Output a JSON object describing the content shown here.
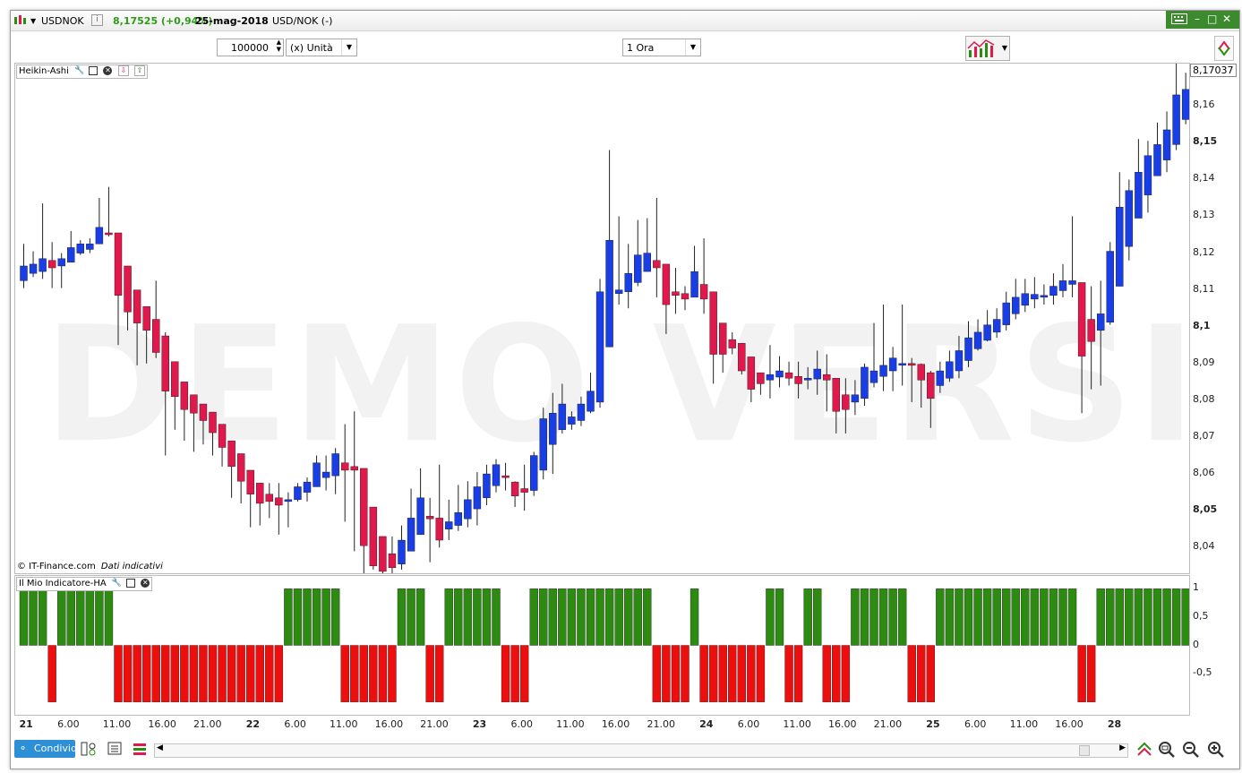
{
  "title_bar": {
    "symbol": "USDNOK",
    "price_change": "8,17525 (+0,94%)",
    "date": "25-mag-2018",
    "pair": "USD/NOK (-)"
  },
  "toolbar": {
    "quantity": "100000",
    "unit": "(x) Unità",
    "timeframe": "1 Ora"
  },
  "price_pane": {
    "label": "Heikin-Ashi",
    "current_price_tag": "8,17037",
    "copyright": "© IT-Finance.com",
    "disclaimer": "Dati indicativi",
    "watermark": "DEMO VERSION",
    "y_ticks": [
      "8,16",
      "8,15",
      "8,14",
      "8,13",
      "8,12",
      "8,11",
      "8,1",
      "8,09",
      "8,08",
      "8,07",
      "8,06",
      "8,05",
      "8,04"
    ]
  },
  "indicator_pane": {
    "label": "Il Mio Indicatore-HA",
    "y_ticks": [
      "1",
      "0,5",
      "0",
      "-0,5"
    ]
  },
  "x_axis": {
    "ticks": [
      "21",
      "6.00",
      "11.00",
      "16.00",
      "21.00",
      "22",
      "6.00",
      "11.00",
      "16.00",
      "21.00",
      "23",
      "6.00",
      "11.00",
      "16.00",
      "21.00",
      "24",
      "6.00",
      "11.00",
      "16.00",
      "21.00",
      "25",
      "6.00",
      "11.00",
      "16.00",
      "28"
    ],
    "day_ticks": [
      "21",
      "22",
      "23",
      "24",
      "25",
      "28"
    ]
  },
  "bottom_bar": {
    "share_label": "Condividi"
  },
  "colors": {
    "bull": "#1a3ee6",
    "bear": "#e0184c",
    "ind_pos": "#2e8b12",
    "ind_neg": "#ee0e0e",
    "accent": "#3d8a2e"
  },
  "chart_data": {
    "type": "candlestick",
    "ylim": [
      8.033,
      8.1715
    ],
    "candles": [
      {
        "o": 8.1125,
        "c": 8.1165,
        "h": 8.1225,
        "l": 8.1105,
        "dir": "up"
      },
      {
        "o": 8.1145,
        "c": 8.117,
        "h": 8.1205,
        "l": 8.1135,
        "dir": "up"
      },
      {
        "o": 8.115,
        "c": 8.1185,
        "h": 8.1335,
        "l": 8.113,
        "dir": "up"
      },
      {
        "o": 8.118,
        "c": 8.116,
        "h": 8.123,
        "l": 8.1105,
        "dir": "down"
      },
      {
        "o": 8.1165,
        "c": 8.1185,
        "h": 8.12,
        "l": 8.1105,
        "dir": "up"
      },
      {
        "o": 8.1175,
        "c": 8.1215,
        "h": 8.126,
        "l": 8.1175,
        "dir": "up"
      },
      {
        "o": 8.12,
        "c": 8.1225,
        "h": 8.1235,
        "l": 8.1195,
        "dir": "up"
      },
      {
        "o": 8.121,
        "c": 8.1225,
        "h": 8.124,
        "l": 8.12,
        "dir": "up"
      },
      {
        "o": 8.1225,
        "c": 8.127,
        "h": 8.135,
        "l": 8.1225,
        "dir": "up"
      },
      {
        "o": 8.1255,
        "c": 8.125,
        "h": 8.138,
        "l": 8.1245,
        "dir": "down"
      },
      {
        "o": 8.1255,
        "c": 8.1085,
        "h": 8.1255,
        "l": 8.095,
        "dir": "down"
      },
      {
        "o": 8.1165,
        "c": 8.104,
        "h": 8.1165,
        "l": 8.099,
        "dir": "down"
      },
      {
        "o": 8.11,
        "c": 8.101,
        "h": 8.11,
        "l": 8.0895,
        "dir": "down"
      },
      {
        "o": 8.1055,
        "c": 8.099,
        "h": 8.1055,
        "l": 8.09,
        "dir": "down"
      },
      {
        "o": 8.102,
        "c": 8.093,
        "h": 8.1125,
        "l": 8.0915,
        "dir": "down"
      },
      {
        "o": 8.0975,
        "c": 8.0825,
        "h": 8.0985,
        "l": 8.065,
        "dir": "down"
      },
      {
        "o": 8.0905,
        "c": 8.081,
        "h": 8.0905,
        "l": 8.072,
        "dir": "down"
      },
      {
        "o": 8.085,
        "c": 8.0775,
        "h": 8.085,
        "l": 8.069,
        "dir": "down"
      },
      {
        "o": 8.0815,
        "c": 8.0765,
        "h": 8.0815,
        "l": 8.066,
        "dir": "down"
      },
      {
        "o": 8.079,
        "c": 8.0745,
        "h": 8.079,
        "l": 8.068,
        "dir": "down"
      },
      {
        "o": 8.0768,
        "c": 8.0712,
        "h": 8.0768,
        "l": 8.065,
        "dir": "down"
      },
      {
        "o": 8.0735,
        "c": 8.0672,
        "h": 8.0735,
        "l": 8.062,
        "dir": "down"
      },
      {
        "o": 8.069,
        "c": 8.062,
        "h": 8.069,
        "l": 8.0535,
        "dir": "down"
      },
      {
        "o": 8.0655,
        "c": 8.058,
        "h": 8.0655,
        "l": 8.052,
        "dir": "down"
      },
      {
        "o": 8.061,
        "c": 8.0545,
        "h": 8.061,
        "l": 8.0455,
        "dir": "down"
      },
      {
        "o": 8.0575,
        "c": 8.052,
        "h": 8.0575,
        "l": 8.046,
        "dir": "down"
      },
      {
        "o": 8.0545,
        "c": 8.0525,
        "h": 8.0575,
        "l": 8.048,
        "dir": "down"
      },
      {
        "o": 8.0535,
        "c": 8.0515,
        "h": 8.0575,
        "l": 8.0435,
        "dir": "down"
      },
      {
        "o": 8.0525,
        "c": 8.053,
        "h": 8.055,
        "l": 8.0455,
        "dir": "up"
      },
      {
        "o": 8.053,
        "c": 8.0565,
        "h": 8.0575,
        "l": 8.0525,
        "dir": "up"
      },
      {
        "o": 8.055,
        "c": 8.0578,
        "h": 8.059,
        "l": 8.0525,
        "dir": "up"
      },
      {
        "o": 8.0565,
        "c": 8.063,
        "h": 8.065,
        "l": 8.0565,
        "dir": "up"
      },
      {
        "o": 8.059,
        "c": 8.0605,
        "h": 8.065,
        "l": 8.0555,
        "dir": "up"
      },
      {
        "o": 8.0595,
        "c": 8.0655,
        "h": 8.067,
        "l": 8.0545,
        "dir": "up"
      },
      {
        "o": 8.063,
        "c": 8.061,
        "h": 8.0735,
        "l": 8.047,
        "dir": "down"
      },
      {
        "o": 8.062,
        "c": 8.061,
        "h": 8.077,
        "l": 8.039,
        "dir": "down"
      },
      {
        "o": 8.0615,
        "c": 8.0405,
        "h": 8.0615,
        "l": 8.033,
        "dir": "down"
      },
      {
        "o": 8.051,
        "c": 8.035,
        "h": 8.051,
        "l": 8.034,
        "dir": "down"
      },
      {
        "o": 8.043,
        "c": 8.0335,
        "h": 8.043,
        "l": 8.031,
        "dir": "down"
      },
      {
        "o": 8.0383,
        "c": 8.0345,
        "h": 8.043,
        "l": 8.032,
        "dir": "down"
      },
      {
        "o": 8.0355,
        "c": 8.042,
        "h": 8.046,
        "l": 8.034,
        "dir": "up"
      },
      {
        "o": 8.039,
        "c": 8.048,
        "h": 8.056,
        "l": 8.039,
        "dir": "up"
      },
      {
        "o": 8.0435,
        "c": 8.0535,
        "h": 8.0615,
        "l": 8.0435,
        "dir": "up"
      },
      {
        "o": 8.0485,
        "c": 8.0478,
        "h": 8.0535,
        "l": 8.036,
        "dir": "down"
      },
      {
        "o": 8.048,
        "c": 8.042,
        "h": 8.0625,
        "l": 8.04,
        "dir": "down"
      },
      {
        "o": 8.045,
        "c": 8.047,
        "h": 8.053,
        "l": 8.042,
        "dir": "up"
      },
      {
        "o": 8.046,
        "c": 8.0495,
        "h": 8.057,
        "l": 8.0445,
        "dir": "up"
      },
      {
        "o": 8.0478,
        "c": 8.053,
        "h": 8.058,
        "l": 8.0455,
        "dir": "up"
      },
      {
        "o": 8.0505,
        "c": 8.0565,
        "h": 8.0605,
        "l": 8.046,
        "dir": "up"
      },
      {
        "o": 8.0535,
        "c": 8.06,
        "h": 8.0625,
        "l": 8.0515,
        "dir": "up"
      },
      {
        "o": 8.0568,
        "c": 8.0625,
        "h": 8.064,
        "l": 8.055,
        "dir": "up"
      },
      {
        "o": 8.0595,
        "c": 8.059,
        "h": 8.063,
        "l": 8.0555,
        "dir": "down"
      },
      {
        "o": 8.0578,
        "c": 8.054,
        "h": 8.058,
        "l": 8.051,
        "dir": "down"
      },
      {
        "o": 8.056,
        "c": 8.055,
        "h": 8.0625,
        "l": 8.05,
        "dir": "down"
      },
      {
        "o": 8.0555,
        "c": 8.065,
        "h": 8.066,
        "l": 8.054,
        "dir": "up"
      },
      {
        "o": 8.061,
        "c": 8.075,
        "h": 8.078,
        "l": 8.0585,
        "dir": "up"
      },
      {
        "o": 8.068,
        "c": 8.0765,
        "h": 8.082,
        "l": 8.06,
        "dir": "up"
      },
      {
        "o": 8.072,
        "c": 8.079,
        "h": 8.0845,
        "l": 8.071,
        "dir": "up"
      },
      {
        "o": 8.0755,
        "c": 8.0735,
        "h": 8.077,
        "l": 8.072,
        "dir": "up"
      },
      {
        "o": 8.0745,
        "c": 8.079,
        "h": 8.081,
        "l": 8.073,
        "dir": "up"
      },
      {
        "o": 8.077,
        "c": 8.0825,
        "h": 8.0875,
        "l": 8.0765,
        "dir": "up"
      },
      {
        "o": 8.0795,
        "c": 8.1095,
        "h": 8.113,
        "l": 8.078,
        "dir": "up"
      },
      {
        "o": 8.0945,
        "c": 8.1235,
        "h": 8.148,
        "l": 8.0945,
        "dir": "up"
      },
      {
        "o": 8.109,
        "c": 8.11,
        "h": 8.13,
        "l": 8.106,
        "dir": "up"
      },
      {
        "o": 8.1095,
        "c": 8.1145,
        "h": 8.1225,
        "l": 8.105,
        "dir": "up"
      },
      {
        "o": 8.112,
        "c": 8.1195,
        "h": 8.129,
        "l": 8.111,
        "dir": "up"
      },
      {
        "o": 8.115,
        "c": 8.12,
        "h": 8.1295,
        "l": 8.115,
        "dir": "up"
      },
      {
        "o": 8.118,
        "c": 8.116,
        "h": 8.135,
        "l": 8.108,
        "dir": "down"
      },
      {
        "o": 8.117,
        "c": 8.106,
        "h": 8.117,
        "l": 8.098,
        "dir": "down"
      },
      {
        "o": 8.1095,
        "c": 8.1085,
        "h": 8.116,
        "l": 8.1035,
        "dir": "down"
      },
      {
        "o": 8.109,
        "c": 8.1075,
        "h": 8.111,
        "l": 8.1045,
        "dir": "down"
      },
      {
        "o": 8.108,
        "c": 8.115,
        "h": 8.122,
        "l": 8.108,
        "dir": "up"
      },
      {
        "o": 8.1115,
        "c": 8.1075,
        "h": 8.124,
        "l": 8.1035,
        "dir": "down"
      },
      {
        "o": 8.1095,
        "c": 8.0925,
        "h": 8.1095,
        "l": 8.0845,
        "dir": "down"
      },
      {
        "o": 8.101,
        "c": 8.0925,
        "h": 8.101,
        "l": 8.0875,
        "dir": "down"
      },
      {
        "o": 8.0965,
        "c": 8.0942,
        "h": 8.0985,
        "l": 8.0925,
        "dir": "down"
      },
      {
        "o": 8.0955,
        "c": 8.088,
        "h": 8.0955,
        "l": 8.087,
        "dir": "down"
      },
      {
        "o": 8.0918,
        "c": 8.083,
        "h": 8.0918,
        "l": 8.0795,
        "dir": "down"
      },
      {
        "o": 8.0875,
        "c": 8.0845,
        "h": 8.0875,
        "l": 8.0815,
        "dir": "down"
      },
      {
        "o": 8.0855,
        "c": 8.087,
        "h": 8.095,
        "l": 8.0805,
        "dir": "up"
      },
      {
        "o": 8.0863,
        "c": 8.088,
        "h": 8.092,
        "l": 8.0835,
        "dir": "up"
      },
      {
        "o": 8.0875,
        "c": 8.086,
        "h": 8.0905,
        "l": 8.084,
        "dir": "down"
      },
      {
        "o": 8.0865,
        "c": 8.0845,
        "h": 8.0905,
        "l": 8.0805,
        "dir": "down"
      },
      {
        "o": 8.0855,
        "c": 8.086,
        "h": 8.089,
        "l": 8.083,
        "dir": "up"
      },
      {
        "o": 8.0858,
        "c": 8.0885,
        "h": 8.0935,
        "l": 8.0815,
        "dir": "up"
      },
      {
        "o": 8.087,
        "c": 8.0855,
        "h": 8.0925,
        "l": 8.077,
        "dir": "down"
      },
      {
        "o": 8.086,
        "c": 8.077,
        "h": 8.086,
        "l": 8.071,
        "dir": "down"
      },
      {
        "o": 8.0815,
        "c": 8.0775,
        "h": 8.086,
        "l": 8.071,
        "dir": "down"
      },
      {
        "o": 8.0795,
        "c": 8.0815,
        "h": 8.0855,
        "l": 8.076,
        "dir": "up"
      },
      {
        "o": 8.0805,
        "c": 8.089,
        "h": 8.09,
        "l": 8.0785,
        "dir": "up"
      },
      {
        "o": 8.0848,
        "c": 8.088,
        "h": 8.101,
        "l": 8.0835,
        "dir": "up"
      },
      {
        "o": 8.0865,
        "c": 8.0895,
        "h": 8.106,
        "l": 8.0825,
        "dir": "up"
      },
      {
        "o": 8.088,
        "c": 8.0915,
        "h": 8.0945,
        "l": 8.0825,
        "dir": "up"
      },
      {
        "o": 8.0898,
        "c": 8.09,
        "h": 8.106,
        "l": 8.084,
        "dir": "up"
      },
      {
        "o": 8.09,
        "c": 8.0895,
        "h": 8.0915,
        "l": 8.0795,
        "dir": "down"
      },
      {
        "o": 8.0898,
        "c": 8.0855,
        "h": 8.09,
        "l": 8.078,
        "dir": "down"
      },
      {
        "o": 8.0875,
        "c": 8.0805,
        "h": 8.088,
        "l": 8.0725,
        "dir": "down"
      },
      {
        "o": 8.084,
        "c": 8.088,
        "h": 8.0905,
        "l": 8.082,
        "dir": "up"
      },
      {
        "o": 8.086,
        "c": 8.0905,
        "h": 8.0935,
        "l": 8.085,
        "dir": "up"
      },
      {
        "o": 8.088,
        "c": 8.0935,
        "h": 8.0975,
        "l": 8.086,
        "dir": "up"
      },
      {
        "o": 8.0908,
        "c": 8.097,
        "h": 8.1015,
        "l": 8.089,
        "dir": "up"
      },
      {
        "o": 8.094,
        "c": 8.0985,
        "h": 8.102,
        "l": 8.0935,
        "dir": "up"
      },
      {
        "o": 8.0963,
        "c": 8.1005,
        "h": 8.1045,
        "l": 8.096,
        "dir": "up"
      },
      {
        "o": 8.0985,
        "c": 8.102,
        "h": 8.105,
        "l": 8.097,
        "dir": "up"
      },
      {
        "o": 8.1005,
        "c": 8.1065,
        "h": 8.1095,
        "l": 8.099,
        "dir": "up"
      },
      {
        "o": 8.1035,
        "c": 8.108,
        "h": 8.113,
        "l": 8.102,
        "dir": "up"
      },
      {
        "o": 8.1058,
        "c": 8.109,
        "h": 8.113,
        "l": 8.104,
        "dir": "up"
      },
      {
        "o": 8.1075,
        "c": 8.1088,
        "h": 8.1135,
        "l": 8.105,
        "dir": "up"
      },
      {
        "o": 8.108,
        "c": 8.1085,
        "h": 8.1115,
        "l": 8.106,
        "dir": "up"
      },
      {
        "o": 8.1085,
        "c": 8.111,
        "h": 8.1145,
        "l": 8.106,
        "dir": "up"
      },
      {
        "o": 8.1098,
        "c": 8.1125,
        "h": 8.117,
        "l": 8.108,
        "dir": "up"
      },
      {
        "o": 8.1115,
        "c": 8.1125,
        "h": 8.13,
        "l": 8.108,
        "dir": "up"
      },
      {
        "o": 8.112,
        "c": 8.092,
        "h": 8.112,
        "l": 8.0765,
        "dir": "down"
      },
      {
        "o": 8.102,
        "c": 8.096,
        "h": 8.111,
        "l": 8.083,
        "dir": "down"
      },
      {
        "o": 8.099,
        "c": 8.1035,
        "h": 8.1125,
        "l": 8.084,
        "dir": "up"
      },
      {
        "o": 8.1012,
        "c": 8.1205,
        "h": 8.123,
        "l": 8.1005,
        "dir": "up"
      },
      {
        "o": 8.111,
        "c": 8.1325,
        "h": 8.142,
        "l": 8.111,
        "dir": "up"
      },
      {
        "o": 8.1218,
        "c": 8.137,
        "h": 8.14,
        "l": 8.118,
        "dir": "up"
      },
      {
        "o": 8.1295,
        "c": 8.142,
        "h": 8.151,
        "l": 8.1295,
        "dir": "up"
      },
      {
        "o": 8.1358,
        "c": 8.1465,
        "h": 8.1505,
        "l": 8.131,
        "dir": "up"
      },
      {
        "o": 8.141,
        "c": 8.1495,
        "h": 8.1555,
        "l": 8.141,
        "dir": "up"
      },
      {
        "o": 8.1453,
        "c": 8.1535,
        "h": 8.1585,
        "l": 8.142,
        "dir": "up"
      },
      {
        "o": 8.1495,
        "c": 8.163,
        "h": 8.1715,
        "l": 8.148,
        "dir": "up"
      },
      {
        "o": 8.1563,
        "c": 8.1645,
        "h": 8.169,
        "l": 8.155,
        "dir": "up"
      },
      {
        "o": 8.1605,
        "c": 8.162,
        "h": 8.1715,
        "l": 8.158,
        "dir": "up"
      },
      {
        "o": 8.161,
        "c": 8.1705,
        "h": 8.1715,
        "l": 8.16,
        "dir": "up"
      }
    ],
    "indicator": [
      1,
      1,
      1,
      -1,
      1,
      1,
      1,
      1,
      1,
      1,
      -1,
      -1,
      -1,
      -1,
      -1,
      -1,
      -1,
      -1,
      -1,
      -1,
      -1,
      -1,
      -1,
      -1,
      -1,
      -1,
      -1,
      -1,
      1,
      1,
      1,
      1,
      1,
      1,
      -1,
      -1,
      -1,
      -1,
      -1,
      -1,
      1,
      1,
      1,
      -1,
      -1,
      1,
      1,
      1,
      1,
      1,
      1,
      -1,
      -1,
      -1,
      1,
      1,
      1,
      1,
      1,
      1,
      1,
      1,
      1,
      1,
      1,
      1,
      1,
      -1,
      -1,
      -1,
      -1,
      1,
      -1,
      -1,
      -1,
      -1,
      -1,
      -1,
      -1,
      1,
      1,
      -1,
      -1,
      1,
      1,
      -1,
      -1,
      -1,
      1,
      1,
      1,
      1,
      1,
      1,
      -1,
      -1,
      -1,
      1,
      1,
      1,
      1,
      1,
      1,
      1,
      1,
      1,
      1,
      1,
      1,
      1,
      1,
      1,
      -1,
      -1,
      1,
      1,
      1,
      1,
      1,
      1,
      1,
      1,
      1,
      1,
      1
    ]
  }
}
